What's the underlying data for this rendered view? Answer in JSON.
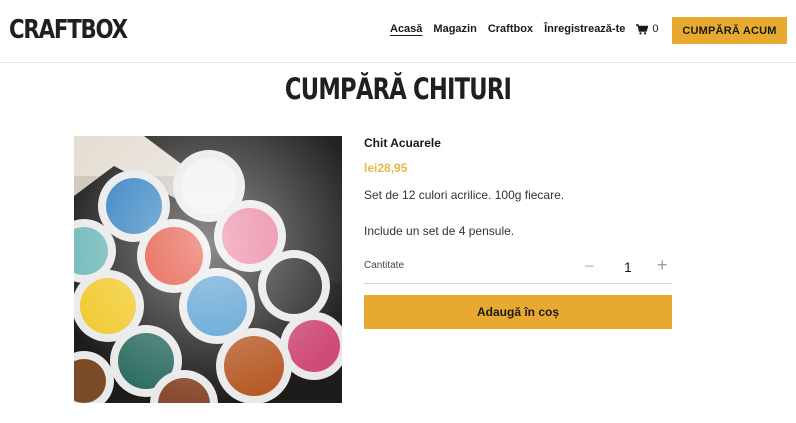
{
  "brand": {
    "logo": "CRAFTBOX"
  },
  "nav": {
    "items": [
      {
        "label": "Acasă",
        "active": true
      },
      {
        "label": "Magazin"
      },
      {
        "label": "Craftbox"
      },
      {
        "label": "Înregistrează-te"
      }
    ],
    "cart_icon": "shopping-cart-icon",
    "cart_count": "0",
    "cta_label": "CUMPĂRĂ ACUM"
  },
  "page": {
    "title": "CUMPĂRĂ CHITURI"
  },
  "product": {
    "image": "paint-jars-photo",
    "name": "Chit Acuarele",
    "price": "lei28,95",
    "description": "Set de 12 culori acrilice. 100g fiecare.",
    "extra": "Include un set de 4 pensule.",
    "quantity_label": "Cantitate",
    "quantity": "1",
    "minus_icon": "minus-icon",
    "plus_icon": "plus-icon",
    "add_to_cart_label": "Adaugă în coș"
  },
  "colors": {
    "accent": "#e8a930",
    "price": "#e8b84a",
    "text": "#1a1a1a"
  }
}
